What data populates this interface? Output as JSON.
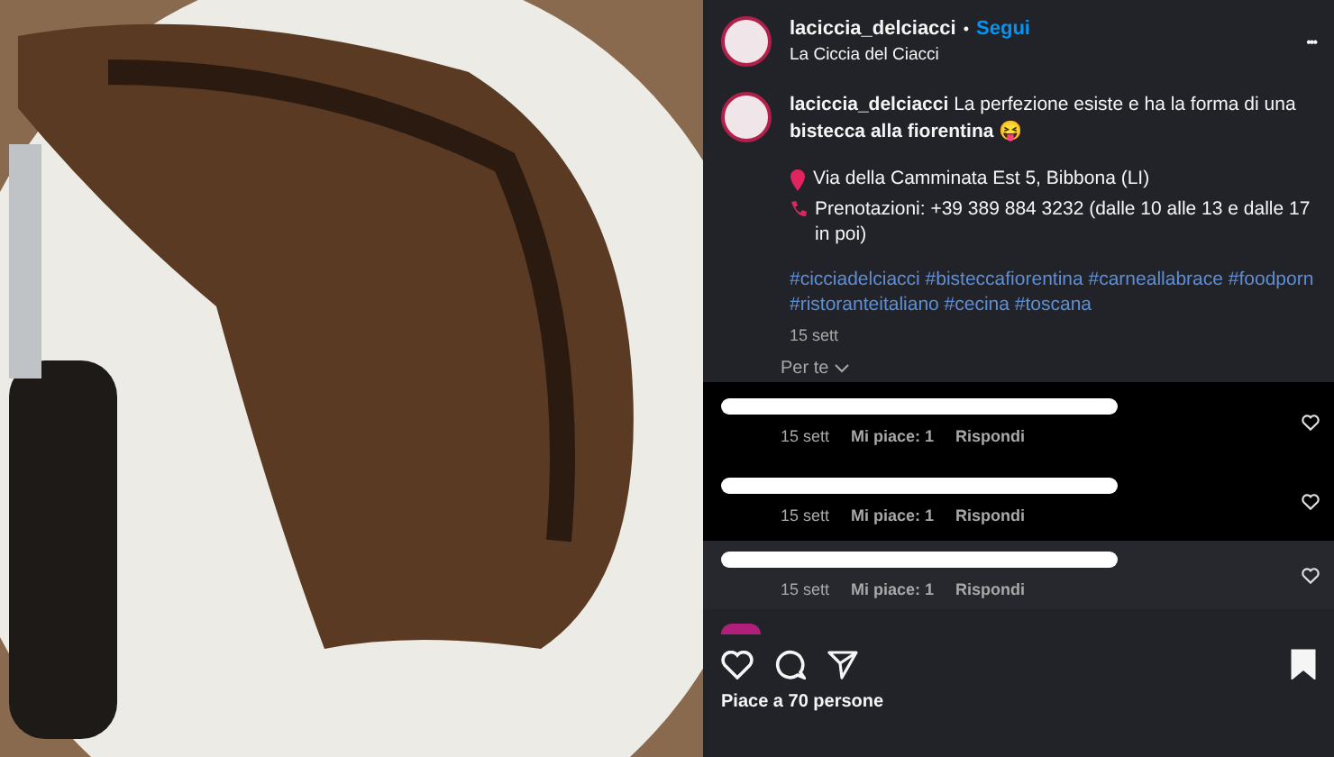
{
  "post_header": {
    "username": "laciccia_delciacci",
    "separator": "•",
    "follow": "Segui",
    "subtitle": "La Ciccia del Ciacci",
    "more": "•••"
  },
  "caption": {
    "username": "laciccia_delciacci",
    "text": "La perfezione esiste e ha la forma di una **bistecca alla fiorentina** 😝",
    "address": "Via della Camminata Est 5, Bibbona (LI)",
    "phone": "Prenotazioni: +39 389 884 3232 (dalle 10 alle 13 e dalle 17 in poi)",
    "hashtags": "#cicciadelciacci #bisteccafiorentina #carneallabrace #foodporn #ristoranteitaliano #cecina #toscana",
    "time": "15 sett"
  },
  "sort": {
    "label": "Per te"
  },
  "comments": [
    {
      "highlighted": true,
      "time": "15 sett",
      "likes": "Mi piace: 1",
      "reply": "Rispondi"
    },
    {
      "highlighted": true,
      "time": "15 sett",
      "likes": "Mi piace: 1",
      "reply": "Rispondi"
    },
    {
      "highlighted": false,
      "time": "15 sett",
      "likes": "Mi piace: 1",
      "reply": "Rispondi"
    }
  ],
  "actions": {
    "saved": true
  },
  "likes": "Piace a 70 persone"
}
